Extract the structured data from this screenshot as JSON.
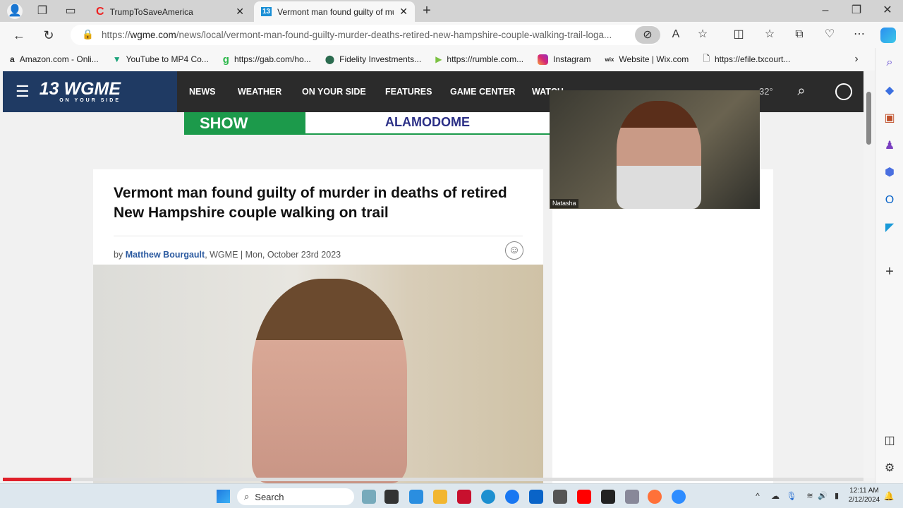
{
  "browser": {
    "tabs": [
      {
        "title": "TrumpToSaveAmerica",
        "active": false
      },
      {
        "title": "Vermont man found guilty of mu",
        "active": true
      }
    ],
    "url_prefix": "https://",
    "url_domain": "wgme.com",
    "url_path": "/news/local/vermont-man-found-guilty-murder-deaths-retired-new-hampshire-couple-walking-trail-loga...",
    "bookmarks": [
      "Amazon.com - Onli...",
      "YouTube to MP4 Co...",
      "https://gab.com/ho...",
      "Fidelity Investments...",
      "https://rumble.com...",
      "Instagram",
      "Website | Wix.com",
      "https://efile.txcourt..."
    ]
  },
  "site": {
    "logo": "13 WGME",
    "logo_sub": "ON YOUR SIDE",
    "nav": [
      "NEWS",
      "WEATHER",
      "ON YOUR SIDE",
      "FEATURES",
      "GAME CENTER",
      "WATCH"
    ],
    "temperature": "32°",
    "ad": {
      "left": "SHOW",
      "right": "ALAMODOME"
    }
  },
  "article": {
    "title": "Vermont man found guilty of murder in deaths of retired New Hampshire couple walking on trail",
    "by": "by ",
    "author": "Matthew Bourgault",
    "byline_rest": ", WGME | Mon, October 23rd 2023"
  },
  "video": {
    "name": "Natasha"
  },
  "taskbar": {
    "search": "Search",
    "time": "12:11 AM",
    "date": "2/12/2024"
  },
  "colors": {
    "nav_navy": "#1f3a63",
    "nav_dark": "#2b2b2b",
    "ad_green": "#1c9a4b",
    "link": "#2b5aa0"
  }
}
